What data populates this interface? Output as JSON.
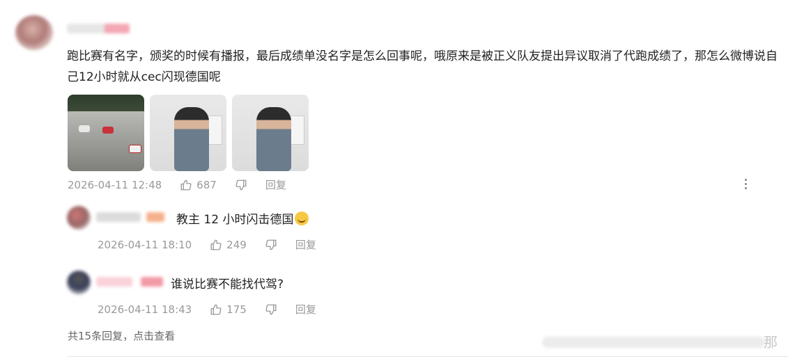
{
  "comment": {
    "text": "跑比赛有名字，颁奖的时候有播报，最后成绩单没名字是怎么回事呢，哦原来是被正义队友提出异议取消了代跑成绩了，那怎么微博说自己12小时就从cec闪现德国呢",
    "time": "2026-04-11 12:48",
    "likes": "687",
    "reply_label": "回复"
  },
  "replies": [
    {
      "text": "教主 12 小时闪击德国",
      "time": "2026-04-11 18:10",
      "likes": "249",
      "reply_label": "回复"
    },
    {
      "text": "谁说比赛不能找代驾?",
      "time": "2026-04-11 18:43",
      "likes": "175",
      "reply_label": "回复"
    }
  ],
  "footer": {
    "total_replies": "共15条回复，点击查看",
    "edge_char": "那"
  },
  "icons": [
    "thumbs-up-icon",
    "thumbs-down-icon",
    "more-icon",
    "grin-emoji"
  ]
}
